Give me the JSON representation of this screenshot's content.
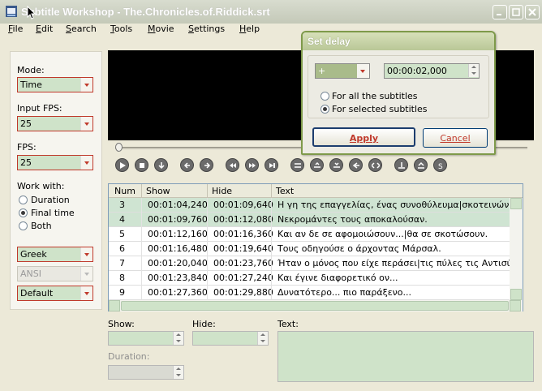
{
  "window": {
    "title": "Subtitle Workshop - The.Chronicles.of.Riddick.srt"
  },
  "menu": [
    "File",
    "Edit",
    "Search",
    "Tools",
    "Movie",
    "Settings",
    "Help"
  ],
  "left": {
    "mode_label": "Mode:",
    "mode_value": "Time",
    "input_fps_label": "Input FPS:",
    "input_fps_value": "25",
    "fps_label": "FPS:",
    "fps_value": "25",
    "work_with_label": "Work with:",
    "work_options": [
      "Duration",
      "Final time",
      "Both"
    ],
    "work_selected": "Final time",
    "charset_value": "Greek",
    "encoding_value": "ANSI",
    "profile_value": "Default"
  },
  "table": {
    "headers": [
      "Num",
      "Show",
      "Hide",
      "Text"
    ],
    "rows": [
      {
        "num": "3",
        "show": "00:01:04,240",
        "hide": "00:01:09,640",
        "text": "Η γη της επαγγελίας, ένας συνοθύλευμα|σκοτεινών νέων κόσ",
        "selected": true
      },
      {
        "num": "4",
        "show": "00:01:09,760",
        "hide": "00:01:12,080",
        "text": "Νεκρομάντες τους αποκαλούσαν.",
        "selected": true
      },
      {
        "num": "5",
        "show": "00:01:12,160",
        "hide": "00:01:16,360",
        "text": "Και αν δε σε αφομοιώσουν...|θα σε σκοτώσουν.",
        "selected": false
      },
      {
        "num": "6",
        "show": "00:01:16,480",
        "hide": "00:01:19,640",
        "text": "Τους οδηγούσε ο άρχοντας Μάρσαλ.",
        "selected": false
      },
      {
        "num": "7",
        "show": "00:01:20,040",
        "hide": "00:01:23,760",
        "text": "Ήταν ο μόνος που είχε περάσει|τις πύλες τις Αντισύμπαν.",
        "selected": false
      },
      {
        "num": "8",
        "show": "00:01:23,840",
        "hide": "00:01:27,240",
        "text": "Και έγινε διαφορετικό ον...",
        "selected": false
      },
      {
        "num": "9",
        "show": "00:01:27,360",
        "hide": "00:01:29,880",
        "text": "Δυνατότερο... πιο παράξενο...",
        "selected": false
      }
    ]
  },
  "bottom": {
    "show_label": "Show:",
    "hide_label": "Hide:",
    "text_label": "Text:",
    "duration_label": "Duration:"
  },
  "dialog": {
    "title": "Set delay",
    "sign_value": "+",
    "delay_value": "00:00:02,000",
    "options": [
      "For all the subtitles",
      "For selected subtitles"
    ],
    "selected_option": "For selected subtitles",
    "apply_label": "Apply",
    "cancel_label": "Cancel"
  },
  "colors": {
    "field_bg": "#cfe3c9",
    "accent_red": "#c0392b",
    "selected_row": "#cfe4d2"
  }
}
